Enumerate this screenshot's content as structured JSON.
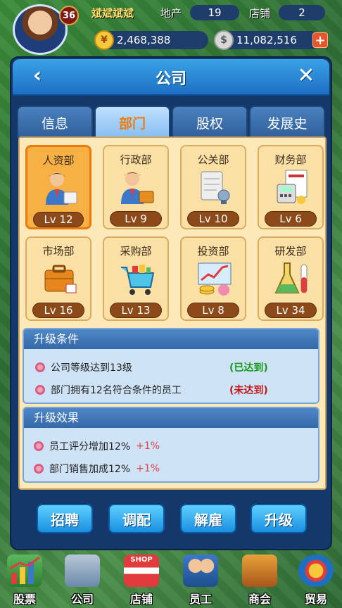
{
  "player": {
    "name": "斌斌斌斌",
    "level": "36"
  },
  "stats": {
    "realestate_label": "地产",
    "realestate_value": "19",
    "shop_label": "店铺",
    "shop_value": "2"
  },
  "money": {
    "cash": "2,468,388",
    "gold": "11,082,516",
    "plus": "+"
  },
  "dialog": {
    "title": "公司",
    "back": "‹",
    "close": "✕"
  },
  "tabs": [
    {
      "label": "信息"
    },
    {
      "label": "部门"
    },
    {
      "label": "股权"
    },
    {
      "label": "发展史"
    }
  ],
  "departments": [
    {
      "name": "人资部",
      "level": "Lv 12",
      "icon": "hr-person-icon"
    },
    {
      "name": "行政部",
      "level": "Lv 9",
      "icon": "admin-person-icon"
    },
    {
      "name": "公关部",
      "level": "Lv 10",
      "icon": "pr-scroll-icon"
    },
    {
      "name": "财务部",
      "level": "Lv 6",
      "icon": "finance-calculator-icon"
    },
    {
      "name": "市场部",
      "level": "Lv 16",
      "icon": "market-briefcase-icon"
    },
    {
      "name": "采购部",
      "level": "Lv 13",
      "icon": "purchase-cart-icon"
    },
    {
      "name": "投资部",
      "level": "Lv 8",
      "icon": "investment-chart-icon"
    },
    {
      "name": "研发部",
      "level": "Lv 34",
      "icon": "research-flask-icon"
    }
  ],
  "upgrade_conditions": {
    "title": "升级条件",
    "items": [
      {
        "text": "公司等级达到13级",
        "status": "(已达到)",
        "color": "#1a9a1a"
      },
      {
        "text": "部门拥有12名符合条件的员工",
        "status": "(未达到)",
        "color": "#c01818"
      }
    ]
  },
  "upgrade_effects": {
    "title": "升级效果",
    "items": [
      {
        "text": "员工评分增加12%",
        "bonus": "+1%"
      },
      {
        "text": "部门销售加成12%",
        "bonus": "+1%"
      }
    ]
  },
  "actions": {
    "recruit": "招聘",
    "allocate": "调配",
    "dismiss": "解雇",
    "upgrade": "升级"
  },
  "nav": [
    {
      "label": "股票"
    },
    {
      "label": "公司"
    },
    {
      "label": "店铺",
      "badge": "SHOP"
    },
    {
      "label": "员工"
    },
    {
      "label": "商会"
    },
    {
      "label": "贸易"
    }
  ],
  "colors": {
    "accent": "#e87d12",
    "header": "#1d6fc4",
    "reached": "#1a9a1a",
    "unreached": "#c01818",
    "bonus": "#e0444a"
  }
}
